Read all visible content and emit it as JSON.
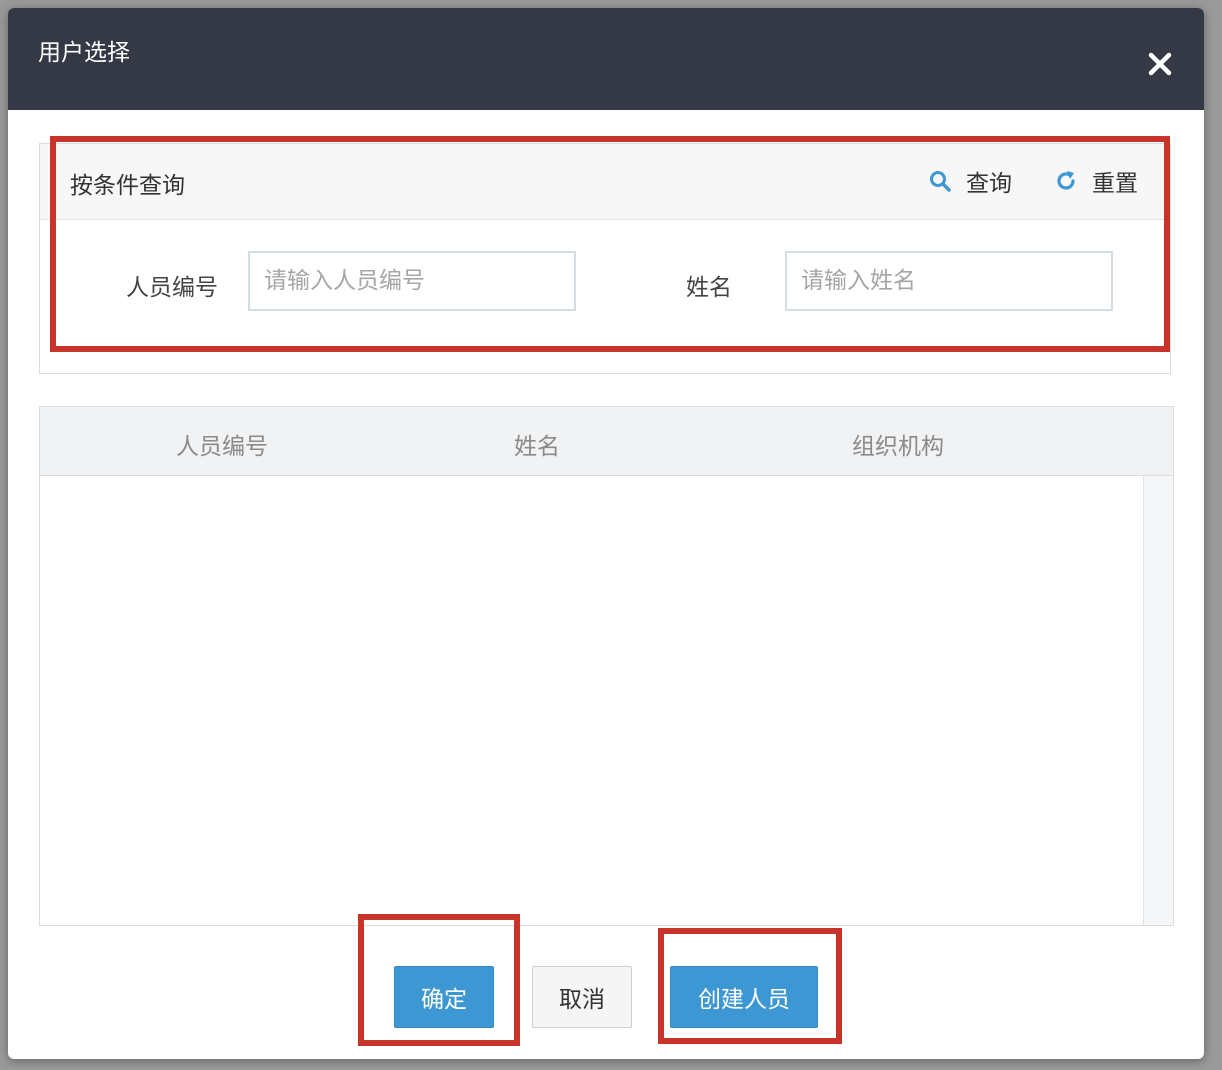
{
  "dialog": {
    "title": "用户选择",
    "close_icon": "close-icon"
  },
  "search": {
    "title": "按条件查询",
    "query_label": "查询",
    "query_icon": "search-icon",
    "reset_label": "重置",
    "reset_icon": "refresh-icon",
    "fields": [
      {
        "label": "人员编号",
        "placeholder": "请输入人员编号",
        "value": ""
      },
      {
        "label": "姓名",
        "placeholder": "请输入姓名",
        "value": ""
      }
    ]
  },
  "table": {
    "columns": [
      "人员编号",
      "姓名",
      "组织机构"
    ],
    "rows": []
  },
  "footer": {
    "confirm_label": "确定",
    "cancel_label": "取消",
    "create_label": "创建人员"
  },
  "colors": {
    "header_bg": "#353845",
    "primary": "#3d97d2",
    "annotation": "#c8332a",
    "icon_accent": "#3d97d2"
  }
}
